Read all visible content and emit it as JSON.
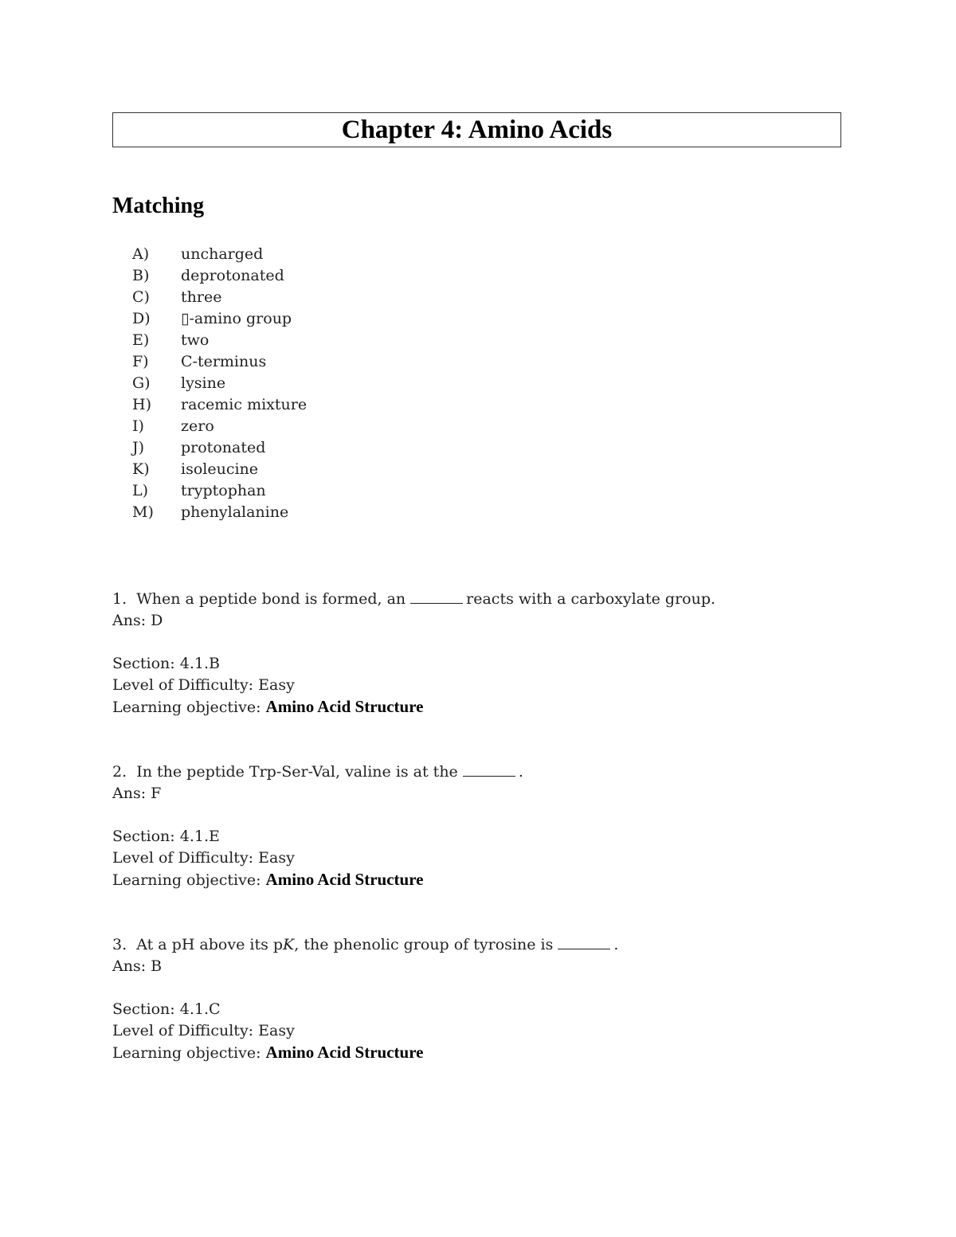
{
  "title": "Chapter 4: Amino Acids",
  "section_heading": "Matching",
  "options": [
    {
      "letter": "A)",
      "text": "uncharged"
    },
    {
      "letter": "B)",
      "text": "deprotonated"
    },
    {
      "letter": "C)",
      "text": "three"
    },
    {
      "letter": "D)",
      "text": "▯-amino group"
    },
    {
      "letter": "E)",
      "text": "two"
    },
    {
      "letter": "F)",
      "text": "C-terminus"
    },
    {
      "letter": "G)",
      "text": "lysine"
    },
    {
      "letter": "H)",
      "text": "racemic mixture"
    },
    {
      "letter": "I)",
      "text": "zero"
    },
    {
      "letter": "J)",
      "text": "protonated"
    },
    {
      "letter": "K)",
      "text": "isoleucine"
    },
    {
      "letter": "L)",
      "text": "tryptophan"
    },
    {
      "letter": "M)",
      "text": "phenylalanine"
    }
  ],
  "questions": [
    {
      "number": "1.",
      "text_before": "When a peptide bond is formed, an",
      "text_after": "reacts with a carboxylate group.",
      "answer": "Ans:  D",
      "section": "Section: 4.1.B",
      "difficulty": "Level of Difficulty:  Easy",
      "objective_label": "Learning objective:",
      "objective_value": "Amino Acid Structure"
    },
    {
      "number": "2.",
      "text_before": "In the peptide Trp-Ser-Val, valine is at the",
      "text_after": ".",
      "answer": "Ans:  F",
      "section": "Section: 4.1.E",
      "difficulty": "Level of Difficulty:  Easy",
      "objective_label": "Learning objective:",
      "objective_value": "Amino Acid Structure"
    },
    {
      "number": "3.",
      "text_before": "At a pH above its p",
      "text_italic": "K",
      "text_mid": ", the phenolic group of tyrosine is",
      "text_after": ".",
      "answer": "Ans:  B",
      "section": "Section: 4.1.C",
      "difficulty": "Level of Difficulty:  Easy",
      "objective_label": "Learning objective:",
      "objective_value": "Amino Acid Structure"
    }
  ]
}
